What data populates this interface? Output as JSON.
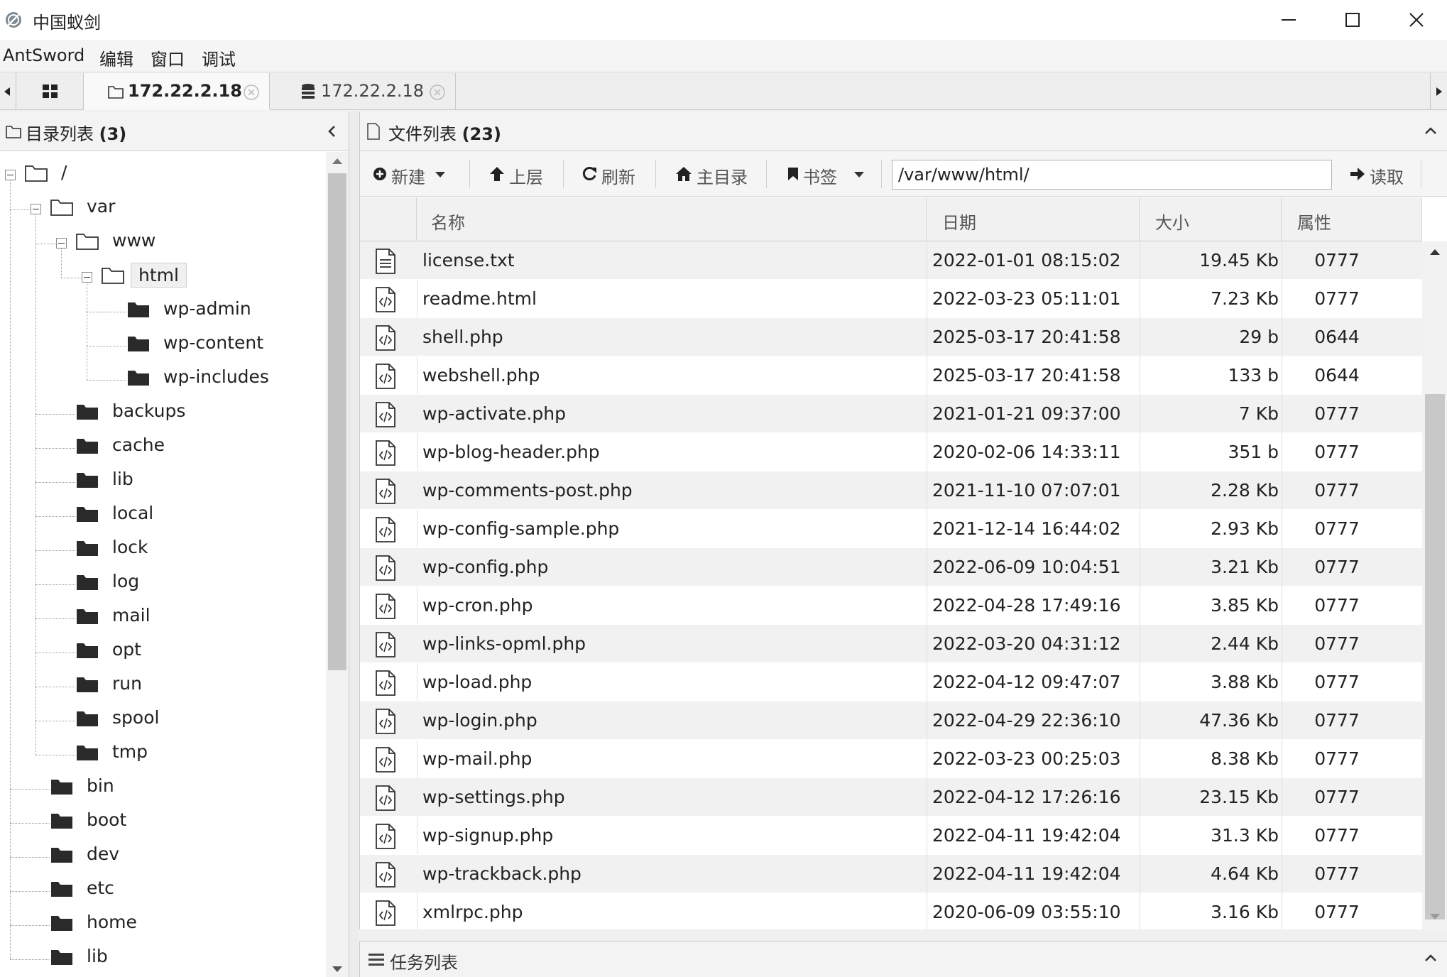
{
  "window": {
    "title": "中国蚁剑"
  },
  "menu": [
    "AntSword",
    "编辑",
    "窗口",
    "调试"
  ],
  "tabs": [
    {
      "label": "172.22.2.18",
      "icon": "folder-icon",
      "active": true
    },
    {
      "label": "172.22.2.18",
      "icon": "database-icon",
      "active": false
    }
  ],
  "left_panel": {
    "title": "目录列表",
    "count": "(3)"
  },
  "tree": [
    {
      "label": "/",
      "level": 0,
      "type": "open-folder",
      "toggle": true
    },
    {
      "label": "var",
      "level": 1,
      "type": "open-folder",
      "toggle": true
    },
    {
      "label": "www",
      "level": 2,
      "type": "open-folder",
      "toggle": true
    },
    {
      "label": "html",
      "level": 3,
      "type": "open-folder",
      "toggle": true,
      "selected": true
    },
    {
      "label": "wp-admin",
      "level": 4,
      "type": "folder"
    },
    {
      "label": "wp-content",
      "level": 4,
      "type": "folder"
    },
    {
      "label": "wp-includes",
      "level": 4,
      "type": "folder"
    },
    {
      "label": "backups",
      "level": 2,
      "type": "folder"
    },
    {
      "label": "cache",
      "level": 2,
      "type": "folder"
    },
    {
      "label": "lib",
      "level": 2,
      "type": "folder"
    },
    {
      "label": "local",
      "level": 2,
      "type": "folder"
    },
    {
      "label": "lock",
      "level": 2,
      "type": "folder"
    },
    {
      "label": "log",
      "level": 2,
      "type": "folder"
    },
    {
      "label": "mail",
      "level": 2,
      "type": "folder"
    },
    {
      "label": "opt",
      "level": 2,
      "type": "folder"
    },
    {
      "label": "run",
      "level": 2,
      "type": "folder"
    },
    {
      "label": "spool",
      "level": 2,
      "type": "folder"
    },
    {
      "label": "tmp",
      "level": 2,
      "type": "folder"
    },
    {
      "label": "bin",
      "level": 1,
      "type": "folder"
    },
    {
      "label": "boot",
      "level": 1,
      "type": "folder"
    },
    {
      "label": "dev",
      "level": 1,
      "type": "folder"
    },
    {
      "label": "etc",
      "level": 1,
      "type": "folder"
    },
    {
      "label": "home",
      "level": 1,
      "type": "folder"
    },
    {
      "label": "lib",
      "level": 1,
      "type": "folder"
    }
  ],
  "right_panel": {
    "title": "文件列表",
    "count": "(23)"
  },
  "toolbar": {
    "new_label": "新建",
    "up_label": "上层",
    "refresh_label": "刷新",
    "home_label": "主目录",
    "bookmark_label": "书签",
    "path_value": "/var/www/html/",
    "read_label": "读取"
  },
  "columns": [
    "名称",
    "日期",
    "大小",
    "属性"
  ],
  "files": [
    {
      "name": "license.txt",
      "date": "2022-01-01 08:15:02",
      "size": "19.45 Kb",
      "attr": "0777",
      "icon": "text-file-icon"
    },
    {
      "name": "readme.html",
      "date": "2022-03-23 05:11:01",
      "size": "7.23 Kb",
      "attr": "0777",
      "icon": "code-file-icon"
    },
    {
      "name": "shell.php",
      "date": "2025-03-17 20:41:58",
      "size": "29 b",
      "attr": "0644",
      "icon": "code-file-icon"
    },
    {
      "name": "webshell.php",
      "date": "2025-03-17 20:41:58",
      "size": "133 b",
      "attr": "0644",
      "icon": "code-file-icon"
    },
    {
      "name": "wp-activate.php",
      "date": "2021-01-21 09:37:00",
      "size": "7 Kb",
      "attr": "0777",
      "icon": "code-file-icon"
    },
    {
      "name": "wp-blog-header.php",
      "date": "2020-02-06 14:33:11",
      "size": "351 b",
      "attr": "0777",
      "icon": "code-file-icon"
    },
    {
      "name": "wp-comments-post.php",
      "date": "2021-11-10 07:07:01",
      "size": "2.28 Kb",
      "attr": "0777",
      "icon": "code-file-icon"
    },
    {
      "name": "wp-config-sample.php",
      "date": "2021-12-14 16:44:02",
      "size": "2.93 Kb",
      "attr": "0777",
      "icon": "code-file-icon"
    },
    {
      "name": "wp-config.php",
      "date": "2022-06-09 10:04:51",
      "size": "3.21 Kb",
      "attr": "0777",
      "icon": "code-file-icon"
    },
    {
      "name": "wp-cron.php",
      "date": "2022-04-28 17:49:16",
      "size": "3.85 Kb",
      "attr": "0777",
      "icon": "code-file-icon"
    },
    {
      "name": "wp-links-opml.php",
      "date": "2022-03-20 04:31:12",
      "size": "2.44 Kb",
      "attr": "0777",
      "icon": "code-file-icon"
    },
    {
      "name": "wp-load.php",
      "date": "2022-04-12 09:47:07",
      "size": "3.88 Kb",
      "attr": "0777",
      "icon": "code-file-icon"
    },
    {
      "name": "wp-login.php",
      "date": "2022-04-29 22:36:10",
      "size": "47.36 Kb",
      "attr": "0777",
      "icon": "code-file-icon"
    },
    {
      "name": "wp-mail.php",
      "date": "2022-03-23 00:25:03",
      "size": "8.38 Kb",
      "attr": "0777",
      "icon": "code-file-icon"
    },
    {
      "name": "wp-settings.php",
      "date": "2022-04-12 17:26:16",
      "size": "23.15 Kb",
      "attr": "0777",
      "icon": "code-file-icon"
    },
    {
      "name": "wp-signup.php",
      "date": "2022-04-11 19:42:04",
      "size": "31.3 Kb",
      "attr": "0777",
      "icon": "code-file-icon"
    },
    {
      "name": "wp-trackback.php",
      "date": "2022-04-11 19:42:04",
      "size": "4.64 Kb",
      "attr": "0777",
      "icon": "code-file-icon"
    },
    {
      "name": "xmlrpc.php",
      "date": "2020-06-09 03:55:10",
      "size": "3.16 Kb",
      "attr": "0777",
      "icon": "code-file-icon"
    }
  ],
  "task_panel": {
    "title": "任务列表"
  },
  "colors": {
    "row_alt": "#f1f1f1",
    "panel_header": "#f3f3f3",
    "scrollbar_thumb": "#c4c4c4"
  }
}
